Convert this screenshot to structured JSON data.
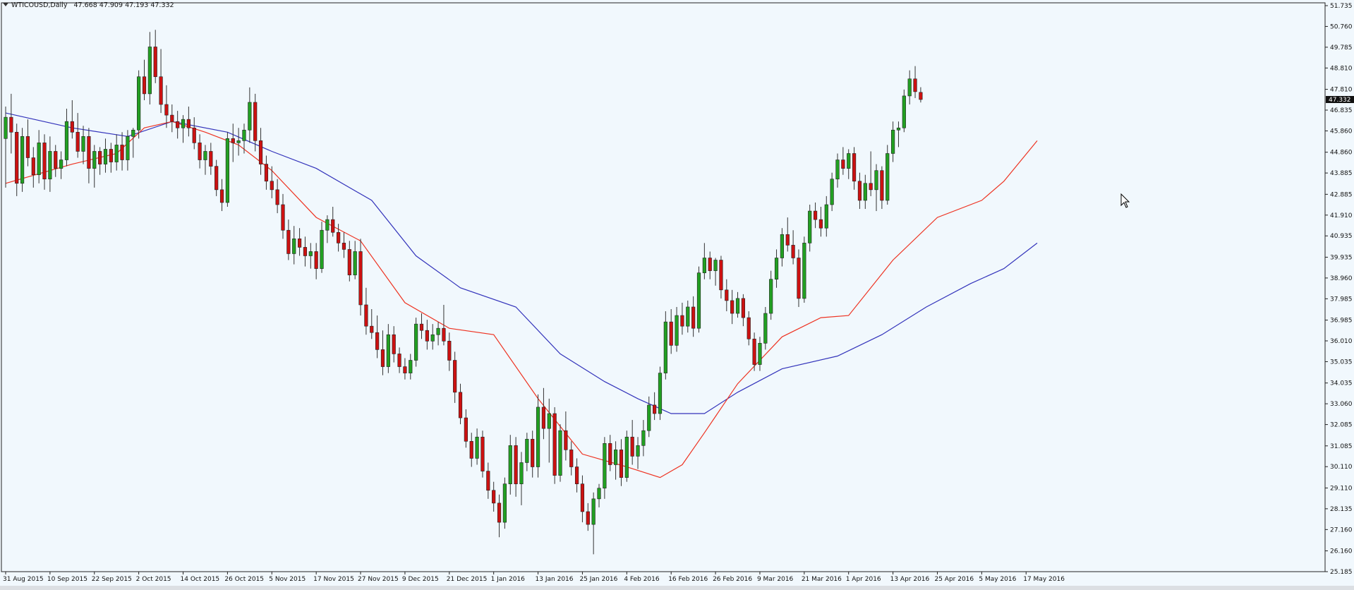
{
  "window": {
    "symbol": "WTICOUSD,Daily",
    "ohlc": [
      "47.668",
      "47.909",
      "47.193",
      "47.332"
    ]
  },
  "chart_data": {
    "type": "candlestick",
    "ylim": [
      25.185,
      51.735
    ],
    "price_ticks": [
      "51.735",
      "50.760",
      "49.785",
      "48.810",
      "47.810",
      "46.835",
      "45.860",
      "44.860",
      "43.885",
      "42.885",
      "41.910",
      "40.935",
      "39.935",
      "38.960",
      "37.985",
      "36.985",
      "36.010",
      "35.035",
      "34.035",
      "33.060",
      "32.085",
      "31.085",
      "30.110",
      "29.110",
      "28.135",
      "27.160",
      "26.160",
      "25.185"
    ],
    "current_price": "47.332",
    "date_labels": [
      "31 Aug 2015",
      "10 Sep 2015",
      "22 Sep 2015",
      "2 Oct 2015",
      "14 Oct 2015",
      "26 Oct 2015",
      "5 Nov 2015",
      "17 Nov 2015",
      "27 Nov 2015",
      "9 Dec 2015",
      "21 Dec 2015",
      "1 Jan 2016",
      "13 Jan 2016",
      "25 Jan 2016",
      "4 Feb 2016",
      "16 Feb 2016",
      "26 Feb 2016",
      "9 Mar 2016",
      "21 Mar 2016",
      "1 Apr 2016",
      "13 Apr 2016",
      "25 Apr 2016",
      "5 May 2016",
      "17 May 2016"
    ],
    "date_label_bars": [
      0,
      8,
      16,
      24,
      32,
      40,
      48,
      56,
      64,
      72,
      80,
      88,
      96,
      104,
      112,
      120,
      128,
      136,
      144,
      152,
      160,
      168,
      176,
      184
    ],
    "ma_fast_color": "#ee3322",
    "ma_slow_color": "#3333bb",
    "bull_color": "#22a022",
    "bear_color": "#cc1111",
    "candles": [
      [
        45.5,
        47.0,
        43.2,
        46.5
      ],
      [
        46.5,
        47.6,
        44.8,
        45.8
      ],
      [
        45.8,
        46.2,
        42.8,
        43.4
      ],
      [
        43.4,
        46.0,
        43.0,
        45.6
      ],
      [
        45.6,
        46.4,
        44.2,
        44.6
      ],
      [
        44.6,
        45.1,
        43.2,
        43.8
      ],
      [
        43.8,
        45.9,
        43.4,
        45.3
      ],
      [
        45.3,
        45.7,
        43.1,
        43.6
      ],
      [
        43.6,
        45.6,
        43.0,
        44.9
      ],
      [
        44.9,
        45.2,
        43.7,
        44.1
      ],
      [
        44.1,
        44.9,
        43.6,
        44.5
      ],
      [
        44.5,
        46.9,
        44.2,
        46.3
      ],
      [
        46.3,
        47.3,
        45.5,
        45.8
      ],
      [
        45.8,
        46.7,
        44.6,
        44.9
      ],
      [
        44.9,
        46.1,
        44.3,
        45.6
      ],
      [
        45.6,
        46.0,
        43.4,
        44.1
      ],
      [
        44.1,
        45.2,
        43.2,
        44.9
      ],
      [
        44.9,
        45.1,
        43.8,
        44.3
      ],
      [
        44.3,
        45.5,
        43.9,
        45.0
      ],
      [
        45.0,
        45.3,
        43.9,
        44.4
      ],
      [
        44.4,
        45.7,
        44.0,
        45.2
      ],
      [
        45.2,
        45.8,
        44.0,
        44.5
      ],
      [
        44.5,
        45.9,
        44.0,
        45.6
      ],
      [
        45.6,
        46.0,
        44.6,
        45.9
      ],
      [
        45.9,
        48.7,
        45.5,
        48.4
      ],
      [
        48.4,
        49.2,
        47.3,
        47.6
      ],
      [
        47.6,
        50.5,
        47.1,
        49.8
      ],
      [
        49.8,
        50.6,
        48.1,
        48.4
      ],
      [
        48.4,
        49.7,
        46.7,
        47.1
      ],
      [
        47.1,
        48.0,
        46.0,
        46.6
      ],
      [
        46.6,
        47.1,
        45.8,
        46.3
      ],
      [
        46.3,
        46.8,
        45.5,
        46.0
      ],
      [
        46.0,
        46.6,
        45.3,
        46.4
      ],
      [
        46.4,
        47.0,
        45.6,
        46.0
      ],
      [
        46.0,
        46.5,
        45.0,
        45.3
      ],
      [
        45.3,
        45.7,
        44.1,
        44.5
      ],
      [
        44.5,
        45.2,
        43.8,
        44.9
      ],
      [
        44.9,
        45.3,
        43.8,
        44.2
      ],
      [
        44.2,
        44.5,
        42.8,
        43.1
      ],
      [
        43.1,
        43.6,
        42.1,
        42.5
      ],
      [
        42.5,
        45.8,
        42.3,
        45.5
      ],
      [
        45.5,
        46.2,
        44.4,
        45.3
      ],
      [
        45.3,
        46.0,
        44.7,
        45.4
      ],
      [
        45.4,
        46.2,
        44.8,
        45.9
      ],
      [
        45.9,
        47.9,
        45.3,
        47.2
      ],
      [
        47.2,
        47.6,
        44.9,
        45.4
      ],
      [
        45.4,
        46.0,
        43.8,
        44.3
      ],
      [
        44.3,
        44.7,
        43.1,
        43.5
      ],
      [
        43.5,
        44.2,
        42.7,
        43.1
      ],
      [
        43.1,
        43.6,
        42.0,
        42.4
      ],
      [
        42.4,
        42.9,
        40.8,
        41.2
      ],
      [
        41.2,
        41.7,
        39.8,
        40.1
      ],
      [
        40.1,
        41.4,
        39.6,
        40.8
      ],
      [
        40.8,
        41.3,
        40.0,
        40.4
      ],
      [
        40.4,
        40.9,
        39.5,
        40.0
      ],
      [
        40.0,
        40.6,
        39.4,
        40.2
      ],
      [
        40.2,
        40.6,
        38.9,
        39.4
      ],
      [
        39.4,
        41.6,
        39.2,
        41.2
      ],
      [
        41.2,
        41.9,
        40.6,
        41.7
      ],
      [
        41.7,
        42.3,
        40.9,
        41.1
      ],
      [
        41.1,
        41.5,
        40.2,
        40.6
      ],
      [
        40.6,
        41.1,
        39.9,
        40.3
      ],
      [
        40.3,
        40.7,
        38.8,
        39.1
      ],
      [
        39.1,
        40.7,
        38.9,
        40.2
      ],
      [
        40.2,
        40.8,
        37.2,
        37.7
      ],
      [
        37.7,
        38.5,
        36.3,
        36.7
      ],
      [
        36.7,
        37.5,
        36.1,
        36.4
      ],
      [
        36.4,
        37.2,
        35.2,
        35.6
      ],
      [
        35.6,
        36.5,
        34.4,
        34.8
      ],
      [
        34.8,
        36.8,
        34.5,
        36.3
      ],
      [
        36.3,
        36.7,
        35.0,
        35.4
      ],
      [
        35.4,
        35.7,
        34.5,
        34.8
      ],
      [
        34.8,
        35.2,
        34.2,
        34.5
      ],
      [
        34.5,
        35.4,
        34.2,
        35.1
      ],
      [
        35.1,
        37.1,
        34.8,
        36.8
      ],
      [
        36.8,
        37.3,
        36.1,
        36.5
      ],
      [
        36.5,
        37.0,
        35.6,
        36.0
      ],
      [
        36.0,
        36.8,
        35.6,
        36.3
      ],
      [
        36.3,
        36.9,
        35.8,
        36.6
      ],
      [
        36.6,
        37.7,
        35.8,
        36.0
      ],
      [
        36.0,
        36.4,
        34.6,
        35.1
      ],
      [
        35.1,
        35.5,
        33.1,
        33.6
      ],
      [
        33.6,
        34.0,
        32.1,
        32.4
      ],
      [
        32.4,
        32.8,
        31.0,
        31.3
      ],
      [
        31.3,
        31.7,
        30.1,
        30.5
      ],
      [
        30.5,
        31.9,
        30.2,
        31.5
      ],
      [
        31.5,
        31.8,
        29.6,
        29.9
      ],
      [
        29.9,
        30.3,
        28.6,
        29.0
      ],
      [
        29.0,
        29.4,
        28.0,
        28.4
      ],
      [
        28.4,
        28.8,
        26.8,
        27.5
      ],
      [
        27.5,
        29.6,
        27.2,
        29.3
      ],
      [
        29.3,
        31.6,
        28.8,
        31.1
      ],
      [
        31.1,
        31.5,
        28.7,
        29.3
      ],
      [
        29.3,
        30.8,
        28.3,
        30.3
      ],
      [
        30.3,
        31.7,
        29.9,
        31.4
      ],
      [
        31.4,
        31.8,
        29.6,
        30.1
      ],
      [
        30.1,
        33.5,
        29.6,
        32.9
      ],
      [
        32.9,
        33.8,
        31.4,
        31.9
      ],
      [
        31.9,
        33.3,
        30.3,
        32.6
      ],
      [
        32.6,
        32.9,
        29.3,
        29.7
      ],
      [
        29.7,
        32.1,
        29.4,
        31.8
      ],
      [
        31.8,
        32.7,
        30.4,
        30.9
      ],
      [
        30.9,
        31.3,
        29.7,
        30.1
      ],
      [
        30.1,
        30.5,
        28.9,
        29.3
      ],
      [
        29.3,
        29.7,
        27.5,
        28.0
      ],
      [
        28.0,
        28.4,
        27.1,
        27.4
      ],
      [
        27.4,
        28.9,
        26.0,
        28.6
      ],
      [
        28.6,
        29.3,
        28.2,
        29.1
      ],
      [
        29.1,
        31.5,
        28.6,
        31.2
      ],
      [
        31.2,
        31.6,
        29.9,
        30.2
      ],
      [
        30.2,
        31.3,
        29.5,
        30.9
      ],
      [
        30.9,
        31.4,
        29.2,
        29.6
      ],
      [
        29.6,
        31.8,
        29.4,
        31.5
      ],
      [
        31.5,
        32.3,
        30.2,
        30.6
      ],
      [
        30.6,
        31.5,
        30.0,
        31.1
      ],
      [
        31.1,
        32.3,
        30.6,
        31.8
      ],
      [
        31.8,
        33.4,
        31.5,
        33.0
      ],
      [
        33.0,
        33.6,
        32.3,
        32.6
      ],
      [
        32.6,
        34.8,
        32.3,
        34.5
      ],
      [
        34.5,
        37.4,
        34.2,
        36.9
      ],
      [
        36.9,
        37.5,
        35.4,
        35.8
      ],
      [
        35.8,
        37.6,
        35.5,
        37.2
      ],
      [
        37.2,
        37.8,
        36.3,
        36.7
      ],
      [
        36.7,
        37.9,
        36.4,
        37.6
      ],
      [
        37.6,
        38.1,
        36.2,
        36.6
      ],
      [
        36.6,
        39.5,
        36.4,
        39.2
      ],
      [
        39.2,
        40.6,
        38.9,
        39.9
      ],
      [
        39.9,
        40.2,
        38.9,
        39.3
      ],
      [
        39.3,
        39.9,
        38.6,
        39.8
      ],
      [
        39.8,
        40.0,
        38.0,
        38.4
      ],
      [
        38.4,
        38.9,
        37.4,
        37.9
      ],
      [
        37.9,
        38.4,
        36.8,
        37.3
      ],
      [
        37.3,
        38.3,
        37.1,
        38.0
      ],
      [
        38.0,
        38.2,
        36.7,
        37.1
      ],
      [
        37.1,
        37.4,
        35.8,
        36.1
      ],
      [
        36.1,
        36.4,
        34.6,
        34.9
      ],
      [
        34.9,
        36.2,
        34.6,
        35.9
      ],
      [
        35.9,
        37.6,
        35.6,
        37.3
      ],
      [
        37.3,
        39.3,
        37.0,
        38.9
      ],
      [
        38.9,
        40.3,
        38.5,
        39.9
      ],
      [
        39.9,
        41.3,
        39.5,
        41.0
      ],
      [
        41.0,
        41.8,
        40.2,
        40.5
      ],
      [
        40.5,
        41.2,
        39.6,
        39.9
      ],
      [
        39.9,
        40.3,
        37.6,
        38.0
      ],
      [
        38.0,
        40.9,
        37.8,
        40.6
      ],
      [
        40.6,
        42.4,
        40.2,
        42.1
      ],
      [
        42.1,
        42.5,
        41.3,
        41.7
      ],
      [
        41.7,
        42.3,
        40.9,
        41.3
      ],
      [
        41.3,
        42.8,
        40.9,
        42.4
      ],
      [
        42.4,
        43.9,
        42.1,
        43.6
      ],
      [
        43.6,
        44.8,
        43.2,
        44.5
      ],
      [
        44.5,
        45.1,
        43.8,
        44.1
      ],
      [
        44.1,
        45.0,
        43.6,
        44.8
      ],
      [
        44.8,
        45.1,
        43.1,
        43.5
      ],
      [
        43.5,
        43.9,
        42.2,
        42.6
      ],
      [
        42.6,
        43.8,
        42.2,
        43.4
      ],
      [
        43.4,
        44.9,
        42.8,
        43.1
      ],
      [
        43.1,
        44.3,
        42.1,
        44.0
      ],
      [
        44.0,
        44.2,
        42.2,
        42.6
      ],
      [
        42.6,
        45.2,
        42.4,
        44.8
      ],
      [
        44.8,
        46.3,
        44.4,
        45.9
      ],
      [
        45.9,
        46.3,
        45.1,
        46.0
      ],
      [
        46.0,
        47.8,
        45.8,
        47.5
      ],
      [
        47.5,
        48.7,
        47.1,
        48.3
      ],
      [
        48.3,
        48.9,
        47.4,
        47.7
      ],
      [
        47.668,
        47.909,
        47.193,
        47.332
      ]
    ],
    "ma_fast": [
      [
        0,
        43.4
      ],
      [
        12,
        44.3
      ],
      [
        20,
        44.8
      ],
      [
        25,
        46.0
      ],
      [
        30,
        46.3
      ],
      [
        36,
        45.8
      ],
      [
        42,
        45.2
      ],
      [
        48,
        44.0
      ],
      [
        56,
        41.8
      ],
      [
        64,
        40.7
      ],
      [
        72,
        37.8
      ],
      [
        80,
        36.6
      ],
      [
        88,
        36.3
      ],
      [
        96,
        33.3
      ],
      [
        104,
        30.7
      ],
      [
        112,
        30.1
      ],
      [
        118,
        29.6
      ],
      [
        122,
        30.2
      ],
      [
        126,
        31.7
      ],
      [
        132,
        34.0
      ],
      [
        140,
        36.2
      ],
      [
        147,
        37.1
      ],
      [
        152,
        37.2
      ],
      [
        160,
        39.8
      ],
      [
        168,
        41.8
      ],
      [
        176,
        42.6
      ],
      [
        180,
        43.5
      ],
      [
        186,
        45.4
      ]
    ],
    "ma_slow": [
      [
        0,
        46.7
      ],
      [
        12,
        46.0
      ],
      [
        22,
        45.6
      ],
      [
        30,
        46.3
      ],
      [
        40,
        45.8
      ],
      [
        48,
        44.9
      ],
      [
        56,
        44.1
      ],
      [
        66,
        42.6
      ],
      [
        74,
        40.0
      ],
      [
        82,
        38.5
      ],
      [
        92,
        37.6
      ],
      [
        100,
        35.4
      ],
      [
        108,
        34.1
      ],
      [
        114,
        33.3
      ],
      [
        120,
        32.6
      ],
      [
        126,
        32.6
      ],
      [
        132,
        33.6
      ],
      [
        140,
        34.7
      ],
      [
        150,
        35.3
      ],
      [
        158,
        36.3
      ],
      [
        166,
        37.6
      ],
      [
        174,
        38.7
      ],
      [
        180,
        39.4
      ],
      [
        186,
        40.6
      ]
    ]
  }
}
